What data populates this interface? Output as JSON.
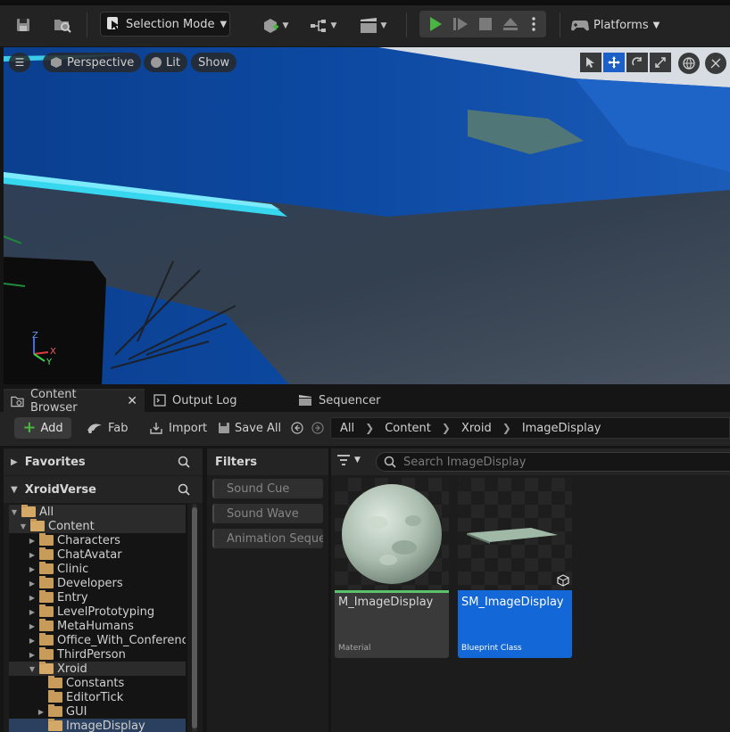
{
  "colors": {
    "play_green": "#4bb543",
    "selection_blue": "#1367d6",
    "material_line": "#59c26a",
    "folder": "#c79b5a"
  },
  "toolbar": {
    "mode_label": "Selection Mode",
    "platforms_label": "Platforms"
  },
  "viewport": {
    "perspective_label": "Perspective",
    "lit_label": "Lit",
    "show_label": "Show",
    "axis_x": "X",
    "axis_y": "Y",
    "axis_z": "Z"
  },
  "tabs": [
    {
      "label": "Content Browser"
    },
    {
      "label": "Output Log"
    },
    {
      "label": "Sequencer"
    }
  ],
  "cb_toolbar": {
    "add_label": "Add",
    "fab_label": "Fab",
    "import_label": "Import",
    "save_all_label": "Save All",
    "breadcrumb": [
      "All",
      "Content",
      "Xroid",
      "ImageDisplay"
    ]
  },
  "left_panel": {
    "favorites_label": "Favorites",
    "project_label": "XroidVerse",
    "tree": [
      {
        "label": "All"
      },
      {
        "label": "Content"
      },
      {
        "label": "Characters"
      },
      {
        "label": "ChatAvatar"
      },
      {
        "label": "Clinic"
      },
      {
        "label": "Developers"
      },
      {
        "label": "Entry"
      },
      {
        "label": "LevelPrototyping"
      },
      {
        "label": "MetaHumans"
      },
      {
        "label": "Office_With_Conference_"
      },
      {
        "label": "ThirdPerson"
      },
      {
        "label": "Xroid"
      },
      {
        "label": "Constants"
      },
      {
        "label": "EditorTick"
      },
      {
        "label": "GUI"
      },
      {
        "label": "ImageDisplay"
      }
    ]
  },
  "filters": {
    "header": "Filters",
    "items": [
      "Sound Cue",
      "Sound Wave",
      "Animation Sequence"
    ]
  },
  "assets": {
    "search_placeholder": "Search ImageDisplay",
    "items": [
      {
        "name": "M_ImageDisplay",
        "type": "Material"
      },
      {
        "name": "SM_ImageDisplay",
        "type": "Blueprint Class"
      }
    ]
  }
}
